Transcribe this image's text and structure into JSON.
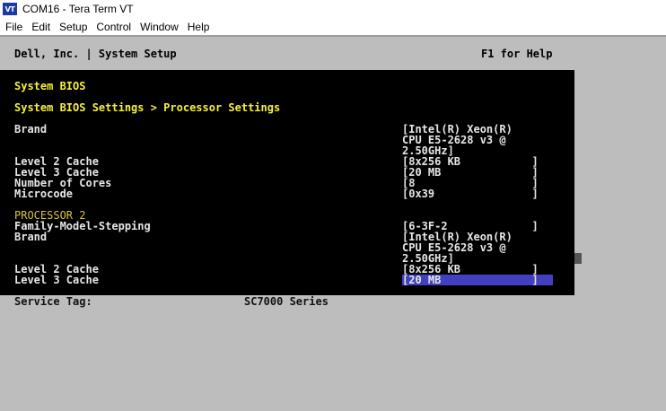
{
  "window": {
    "icon_text": "VT",
    "title": "COM16 - Tera Term VT"
  },
  "menu": [
    "File",
    "Edit",
    "Setup",
    "Control",
    "Window",
    "Help"
  ],
  "header": {
    "left": "Dell, Inc. | System Setup",
    "right": "F1 for Help"
  },
  "bios": {
    "title": "System BIOS",
    "breadcrumb": "System BIOS Settings > Processor Settings",
    "processor1": {
      "brand_label": "Brand",
      "brand_value_1": "[Intel(R) Xeon(R)",
      "brand_value_2": "CPU E5-2628 v3 @",
      "brand_value_3": "2.50GHz]",
      "l2_label": "Level 2 Cache",
      "l2_value": "[8x256 KB           ]",
      "l3_label": "Level 3 Cache",
      "l3_value": "[20 MB              ]",
      "cores_label": "Number of Cores",
      "cores_value": "[8                  ]",
      "microcode_label": "Microcode",
      "microcode_value": "[0x39               ]"
    },
    "processor2": {
      "section_title": "PROCESSOR 2",
      "fms_label": "Family-Model-Stepping",
      "fms_value": "[6-3F-2             ]",
      "brand_label": "Brand",
      "brand_value_1": "[Intel(R) Xeon(R)",
      "brand_value_2": "CPU E5-2628 v3 @",
      "brand_value_3": "2.50GHz]",
      "l2_label": "Level 2 Cache",
      "l2_value": "[8x256 KB           ]",
      "l3_label": "Level 3 Cache",
      "l3_value": "[20 MB              ]"
    }
  },
  "footer": {
    "service_tag_label": "Service Tag:",
    "service_tag_value": "SC7000 Series"
  },
  "colors": {
    "terminal_bg": "#000000",
    "window_bg": "#bdbdbd",
    "label_text": "#e6e6e6",
    "title_text": "#f6f03a",
    "section_text": "#d6c23a",
    "selection": "#4040c0"
  }
}
